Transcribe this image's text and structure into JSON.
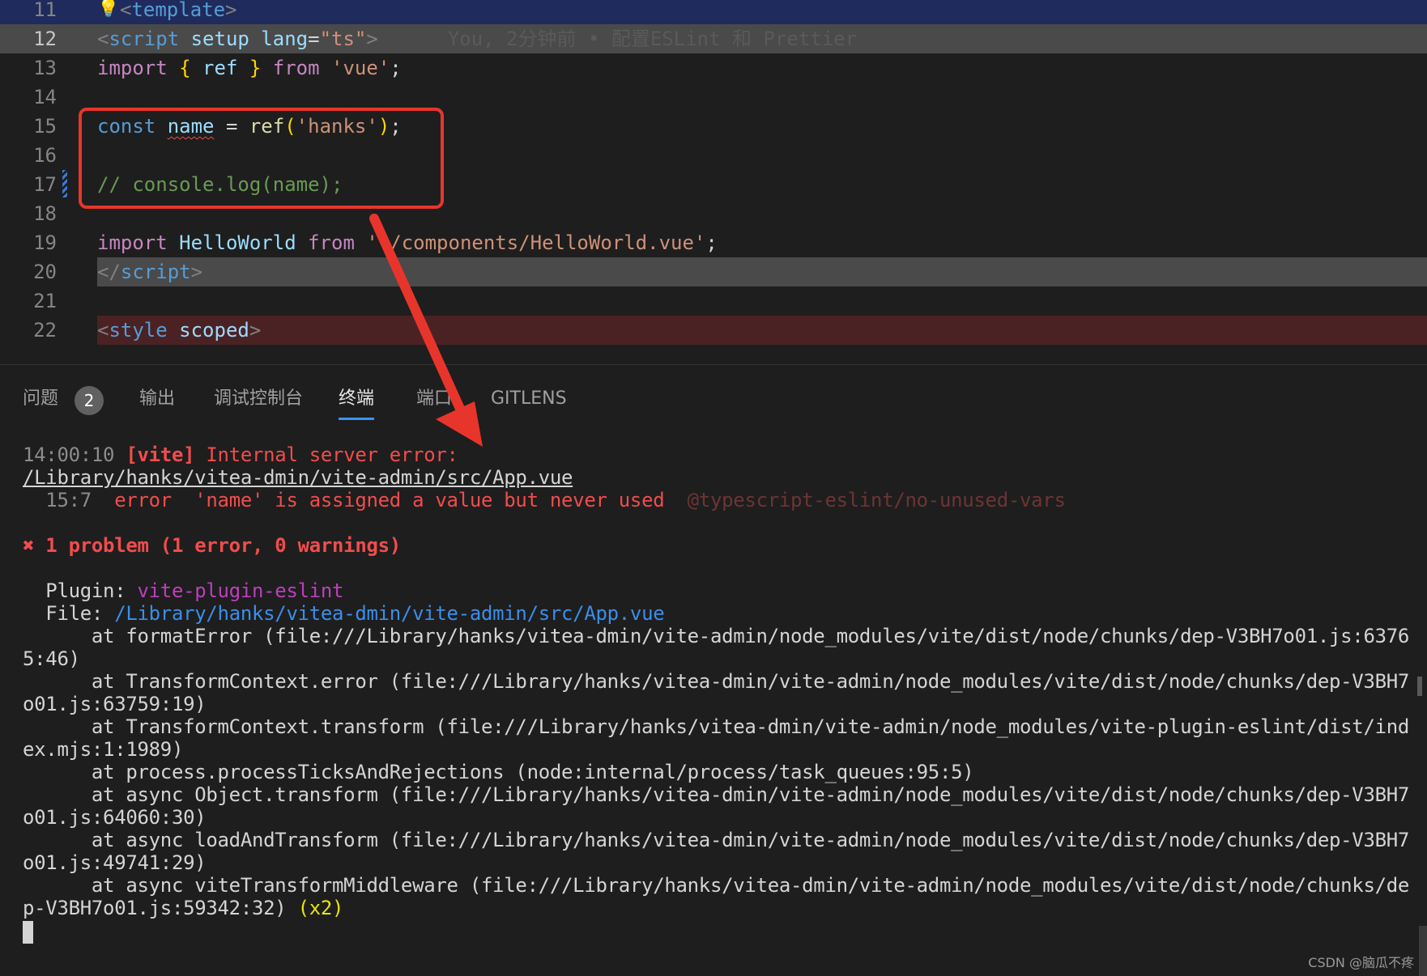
{
  "editor": {
    "lines": [
      {
        "num": "11",
        "parts": [
          {
            "t": "template",
            "c": "k-blue"
          },
          {
            "t": ">",
            "c": "k-gray"
          }
        ]
      },
      {
        "num": "12",
        "current": true,
        "parts": [
          {
            "t": "<",
            "c": "k-gray"
          },
          {
            "t": "script",
            "c": "k-blue"
          },
          {
            "t": " setup",
            "c": "k-attr"
          },
          {
            "t": " lang",
            "c": "k-attr"
          },
          {
            "t": "=",
            "c": "k-white"
          },
          {
            "t": "\"ts\"",
            "c": "k-str"
          },
          {
            "t": ">",
            "c": "k-gray"
          }
        ],
        "blame": "You, 2分钟前 • 配置ESLint 和 Prettier"
      },
      {
        "num": "13",
        "parts": [
          {
            "t": "import",
            "c": "k-purple"
          },
          {
            "t": " ",
            "c": "k-white"
          },
          {
            "t": "{",
            "c": "k-yellow"
          },
          {
            "t": " ref ",
            "c": "k-attr"
          },
          {
            "t": "}",
            "c": "k-yellow"
          },
          {
            "t": " from ",
            "c": "k-purple"
          },
          {
            "t": "'vue'",
            "c": "k-str"
          },
          {
            "t": ";",
            "c": "k-white"
          }
        ]
      },
      {
        "num": "14",
        "parts": []
      },
      {
        "num": "15",
        "parts": [
          {
            "t": "const",
            "c": "k-blue"
          },
          {
            "t": " ",
            "c": "k-white"
          },
          {
            "t": "name",
            "c": "k-attr squiggle"
          },
          {
            "t": " = ",
            "c": "k-white"
          },
          {
            "t": "ref",
            "c": "k-fn"
          },
          {
            "t": "(",
            "c": "k-yellow"
          },
          {
            "t": "'hanks'",
            "c": "k-str"
          },
          {
            "t": ")",
            "c": "k-yellow"
          },
          {
            "t": ";",
            "c": "k-white"
          }
        ]
      },
      {
        "num": "16",
        "parts": []
      },
      {
        "num": "17",
        "parts": [
          {
            "t": "// console.log(name);",
            "c": "k-cmt"
          }
        ]
      },
      {
        "num": "18",
        "parts": []
      },
      {
        "num": "19",
        "parts": [
          {
            "t": "import",
            "c": "k-purple"
          },
          {
            "t": " HelloWorld ",
            "c": "k-attr"
          },
          {
            "t": "from",
            "c": "k-purple"
          },
          {
            "t": " ",
            "c": "k-white"
          },
          {
            "t": "'./components/HelloWorld.vue'",
            "c": "k-str"
          },
          {
            "t": ";",
            "c": "k-white"
          }
        ]
      },
      {
        "num": "20",
        "parts": [
          {
            "t": "</",
            "c": "k-gray"
          },
          {
            "t": "script",
            "c": "k-blue"
          },
          {
            "t": ">",
            "c": "k-gray"
          }
        ]
      },
      {
        "num": "21",
        "parts": []
      },
      {
        "num": "22",
        "parts": [
          {
            "t": "<",
            "c": "k-gray"
          },
          {
            "t": "style",
            "c": "k-blue"
          },
          {
            "t": " scoped",
            "c": "k-attr"
          },
          {
            "t": ">",
            "c": "k-gray"
          }
        ]
      }
    ]
  },
  "panel": {
    "tabs": [
      {
        "label": "问题"
      },
      {
        "label": "输出"
      },
      {
        "label": "调试控制台"
      },
      {
        "label": "终端",
        "active": true
      },
      {
        "label": "端口"
      },
      {
        "label": "GITLENS"
      }
    ],
    "problems_count": "2"
  },
  "terminal": {
    "lines": [
      [
        {
          "t": "14:00:10 ",
          "c": "t-dim"
        },
        {
          "t": "[vite]",
          "c": "t-redbold"
        },
        {
          "t": " Internal server error:",
          "c": "t-red"
        }
      ],
      [
        {
          "t": "/Library/hanks/vitea-dmin/vite-admin/src/App.vue",
          "c": "t-under"
        }
      ],
      [
        {
          "t": "  15:7  ",
          "c": "t-dim"
        },
        {
          "t": "error  'name' is assigned a value but never used  ",
          "c": "t-red"
        },
        {
          "t": "@typescript-eslint/no-unused-vars",
          "c": "t-dimred"
        }
      ],
      [],
      [
        {
          "t": "✖ 1 problem (1 error, 0 warnings)",
          "c": "t-redbold"
        }
      ],
      [],
      [
        {
          "t": "  Plugin: ",
          "c": ""
        },
        {
          "t": "vite-plugin-eslint",
          "c": "t-magenta"
        }
      ],
      [
        {
          "t": "  File: ",
          "c": ""
        },
        {
          "t": "/Library/hanks/vitea-dmin/vite-admin/src/App.vue",
          "c": "t-cyan"
        }
      ],
      [
        {
          "t": "      at formatError (file:///Library/hanks/vitea-dmin/vite-admin/node_modules/vite/dist/node/chunks/dep-V3BH7o01.js:6376",
          "c": ""
        }
      ],
      [
        {
          "t": "5:46)",
          "c": ""
        }
      ],
      [
        {
          "t": "      at TransformContext.error (file:///Library/hanks/vitea-dmin/vite-admin/node_modules/vite/dist/node/chunks/dep-V3BH7",
          "c": ""
        }
      ],
      [
        {
          "t": "o01.js:63759:19)",
          "c": ""
        }
      ],
      [
        {
          "t": "      at TransformContext.transform (file:///Library/hanks/vitea-dmin/vite-admin/node_modules/vite-plugin-eslint/dist/ind",
          "c": ""
        }
      ],
      [
        {
          "t": "ex.mjs:1:1989)",
          "c": ""
        }
      ],
      [
        {
          "t": "      at process.processTicksAndRejections (node:internal/process/task_queues:95:5)",
          "c": ""
        }
      ],
      [
        {
          "t": "      at async Object.transform (file:///Library/hanks/vitea-dmin/vite-admin/node_modules/vite/dist/node/chunks/dep-V3BH7",
          "c": ""
        }
      ],
      [
        {
          "t": "o01.js:64060:30)",
          "c": ""
        }
      ],
      [
        {
          "t": "      at async loadAndTransform (file:///Library/hanks/vitea-dmin/vite-admin/node_modules/vite/dist/node/chunks/dep-V3BH7",
          "c": ""
        }
      ],
      [
        {
          "t": "o01.js:49741:29)",
          "c": ""
        }
      ],
      [
        {
          "t": "      at async viteTransformMiddleware (file:///Library/hanks/vitea-dmin/vite-admin/node_modules/vite/dist/node/chunks/de",
          "c": ""
        }
      ],
      [
        {
          "t": "p-V3BH7o01.js:59342:32) ",
          "c": ""
        },
        {
          "t": "(x2)",
          "c": "t-yellow"
        }
      ]
    ]
  },
  "watermark": "CSDN @脑瓜不疼",
  "colors": {
    "annotation_red": "#e8352c",
    "accent": "#3794ff"
  }
}
